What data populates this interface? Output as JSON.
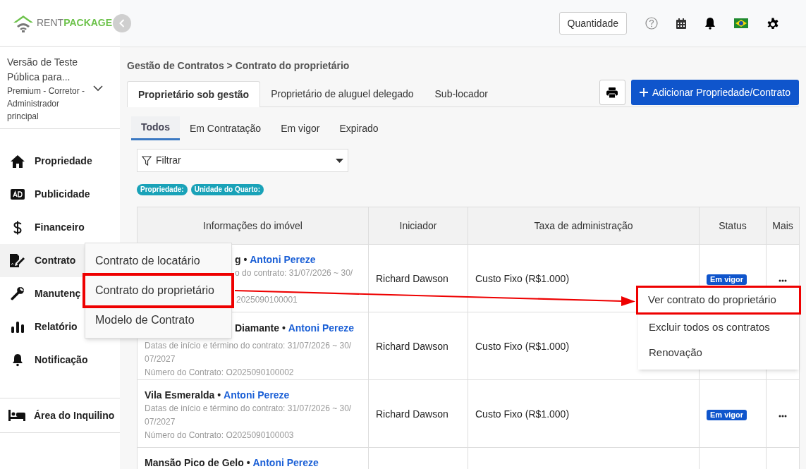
{
  "logo": {
    "first": "RENT",
    "second": "PACKAGE"
  },
  "account": {
    "plan": "Versão de Teste Pública para...",
    "role": "Premium - Corretor - Administrador principal"
  },
  "sidebar": {
    "items": [
      {
        "label": "Propriedade",
        "selected": false
      },
      {
        "label": "Publicidade",
        "selected": false
      },
      {
        "label": "Financeiro",
        "selected": false
      },
      {
        "label": "Contrato",
        "selected": true
      },
      {
        "label": "Manutenç",
        "selected": false
      },
      {
        "label": "Relatório",
        "selected": false
      },
      {
        "label": "Notificação",
        "selected": false
      }
    ],
    "tenant_area": "Área do Inquilino"
  },
  "header": {
    "quantity_button": "Quantidade"
  },
  "breadcrumb": "Gestão de Contratos > Contrato do proprietário",
  "tabs": [
    {
      "label": "Proprietário sob gestão",
      "selected": true
    },
    {
      "label": "Proprietário de aluguel delegado",
      "selected": false
    },
    {
      "label": "Sub-locador",
      "selected": false
    }
  ],
  "add_button": "Adicionar Propriedade/Contrato",
  "status_tabs": [
    {
      "label": "Todos",
      "selected": true
    },
    {
      "label": "Em Contratação",
      "selected": false
    },
    {
      "label": "Em vigor",
      "selected": false
    },
    {
      "label": "Expirado",
      "selected": false
    }
  ],
  "filter": {
    "placeholder": "Filtrar"
  },
  "chips": [
    "Propriedade:",
    "Unidade do Quarto:"
  ],
  "table": {
    "columns": [
      "Informações do imóvel",
      "Iniciador",
      "Taxa de administração",
      "Status",
      "Mais"
    ],
    "rows": [
      {
        "property": "g •",
        "owner": "Antoni Pereze",
        "dates": "o do contrato: 31/07/2026 ~ 30/",
        "number": "2025090100001",
        "initiator": "Richard Dawson",
        "fee": "Custo Fixo (R$1.000)",
        "status": "Em vigor"
      },
      {
        "property": "Diamante •",
        "owner": "Antoni Pereze",
        "dates": "Datas de início e término do contrato: 31/07/2026 ~ 30/07/2027",
        "number": "Número do Contrato: O2025090100002",
        "initiator": "Richard Dawson",
        "fee": "Custo Fixo (R$1.000)"
      },
      {
        "property": "Vila Esmeralda •",
        "owner": "Antoni Pereze",
        "dates": "Datas de início e término do contrato: 31/07/2026 ~ 30/07/2027",
        "number": "Número do Contrato: O2025090100003",
        "initiator": "Richard Dawson",
        "fee": "Custo Fixo (R$1.000)",
        "status": "Em vigor"
      },
      {
        "property": "Mansão Pico de Gelo •",
        "owner": "Antoni Pereze"
      }
    ]
  },
  "contract_menu": {
    "items": [
      {
        "label": "Contrato de locatário",
        "highlighted": false
      },
      {
        "label": "Contrato do proprietário",
        "highlighted": true
      },
      {
        "label": "Modelo de Contrato",
        "highlighted": false
      }
    ]
  },
  "row_menu": {
    "items": [
      {
        "label": "Ver contrato do proprietário",
        "highlighted": true
      },
      {
        "label": "Excluir todos os contratos",
        "highlighted": false
      },
      {
        "label": "Renovação",
        "highlighted": false
      }
    ]
  }
}
